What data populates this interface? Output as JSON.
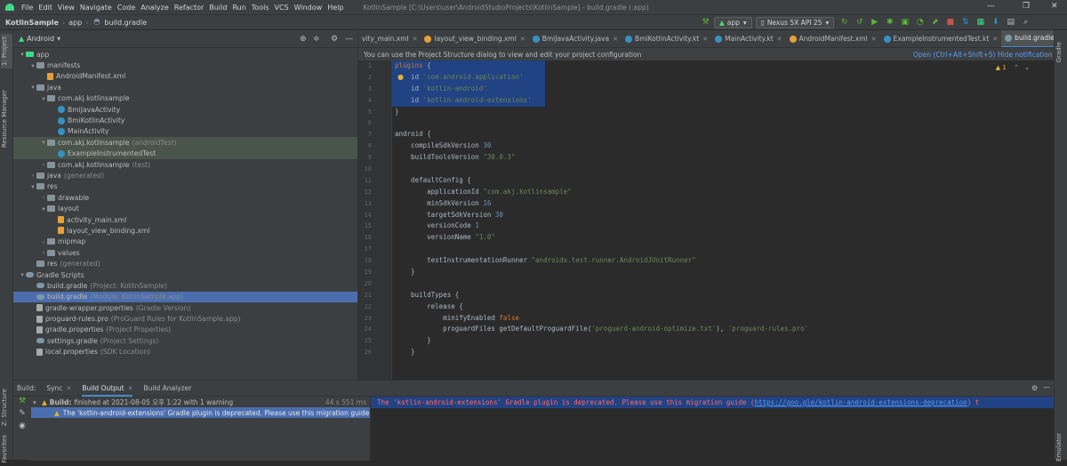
{
  "menubar": {
    "items": [
      "File",
      "Edit",
      "View",
      "Navigate",
      "Code",
      "Analyze",
      "Refactor",
      "Build",
      "Run",
      "Tools",
      "VCS",
      "Window",
      "Help"
    ],
    "title": "KotlinSample [C:\\Users\\user\\AndroidStudioProjects\\KotlinSample] - build.gradle (:app)",
    "minimize": "—",
    "restore": "❐",
    "close": "✕"
  },
  "navbar": {
    "crumbs": [
      "KotlinSample",
      "app",
      "build.gradle"
    ],
    "run_config": "app",
    "device": "Nexus 5X API 25"
  },
  "left_tools": {
    "project": "1: Project",
    "resource": "Resource Manager",
    "structure": "Z: Structure",
    "favorites": "Favorites"
  },
  "right_tools": {
    "gradle": "Gradle",
    "emulator": "Emulator"
  },
  "project": {
    "view": "Android",
    "tree": [
      {
        "label": "app",
        "depth": 0,
        "arrow": "▾",
        "icon": "app"
      },
      {
        "label": "manifests",
        "depth": 1,
        "arrow": "▾",
        "icon": "folder"
      },
      {
        "label": "AndroidManifest.xml",
        "depth": 2,
        "arrow": "",
        "icon": "xml"
      },
      {
        "label": "java",
        "depth": 1,
        "arrow": "▾",
        "icon": "folder"
      },
      {
        "label": "com.akj.kotlinsample",
        "depth": 2,
        "arrow": "▾",
        "icon": "pkg"
      },
      {
        "label": "BmiJavaActivity",
        "depth": 3,
        "arrow": "",
        "icon": "class"
      },
      {
        "label": "BmiKotlinActivity",
        "depth": 3,
        "arrow": "",
        "icon": "class"
      },
      {
        "label": "MainActivity",
        "depth": 3,
        "arrow": "",
        "icon": "class"
      },
      {
        "label": "com.akj.kotlinsample",
        "hint": "(androidTest)",
        "depth": 2,
        "arrow": "▾",
        "icon": "pkg",
        "test": true
      },
      {
        "label": "ExampleInstrumentedTest",
        "depth": 3,
        "arrow": "",
        "icon": "class",
        "test": true
      },
      {
        "label": "com.akj.kotlinsample",
        "hint": "(test)",
        "depth": 2,
        "arrow": "›",
        "icon": "pkg"
      },
      {
        "label": "java",
        "hint": "(generated)",
        "depth": 1,
        "arrow": "›",
        "icon": "folder"
      },
      {
        "label": "res",
        "depth": 1,
        "arrow": "▾",
        "icon": "folder"
      },
      {
        "label": "drawable",
        "depth": 2,
        "arrow": "›",
        "icon": "folder"
      },
      {
        "label": "layout",
        "depth": 2,
        "arrow": "▾",
        "icon": "folder"
      },
      {
        "label": "activity_main.xml",
        "depth": 3,
        "arrow": "",
        "icon": "xml"
      },
      {
        "label": "layout_view_binding.xml",
        "depth": 3,
        "arrow": "",
        "icon": "xml"
      },
      {
        "label": "mipmap",
        "depth": 2,
        "arrow": "›",
        "icon": "folder"
      },
      {
        "label": "values",
        "depth": 2,
        "arrow": "›",
        "icon": "folder"
      },
      {
        "label": "res",
        "hint": "(generated)",
        "depth": 1,
        "arrow": "",
        "icon": "folder"
      },
      {
        "label": "Gradle Scripts",
        "depth": 0,
        "arrow": "▾",
        "icon": "gradle"
      },
      {
        "label": "build.gradle",
        "hint": "(Project: KotlinSample)",
        "depth": 1,
        "arrow": "",
        "icon": "gradle"
      },
      {
        "label": "build.gradle",
        "hint": "(Module: KotlinSample.app)",
        "depth": 1,
        "arrow": "",
        "icon": "gradle",
        "selected": true
      },
      {
        "label": "gradle-wrapper.properties",
        "hint": "(Gradle Version)",
        "depth": 1,
        "arrow": "",
        "icon": "props"
      },
      {
        "label": "proguard-rules.pro",
        "hint": "(ProGuard Rules for KotlinSample.app)",
        "depth": 1,
        "arrow": "",
        "icon": "props"
      },
      {
        "label": "gradle.properties",
        "hint": "(Project Properties)",
        "depth": 1,
        "arrow": "",
        "icon": "props"
      },
      {
        "label": "settings.gradle",
        "hint": "(Project Settings)",
        "depth": 1,
        "arrow": "",
        "icon": "gradle"
      },
      {
        "label": "local.properties",
        "hint": "(SDK Location)",
        "depth": 1,
        "arrow": "",
        "icon": "props"
      }
    ]
  },
  "editor": {
    "tabs": [
      {
        "label": "vity_main.xml",
        "icon": "xml"
      },
      {
        "label": "layout_view_binding.xml",
        "icon": "xml"
      },
      {
        "label": "BmiJavaActivity.java",
        "icon": "class"
      },
      {
        "label": "BmiKotlinActivity.kt",
        "icon": "class"
      },
      {
        "label": "MainActivity.kt",
        "icon": "class"
      },
      {
        "label": "AndroidManifest.xml",
        "icon": "xml"
      },
      {
        "label": "ExampleInstrumentedTest.kt",
        "icon": "class"
      },
      {
        "label": "build.gradle (:app)",
        "icon": "gradle",
        "active": true
      }
    ],
    "info_message": "You can use the Project Structure dialog to view and edit your project configuration",
    "info_open": "Open (Ctrl+Alt+Shift+S)",
    "info_hide": "Hide notification",
    "warning_count": "1",
    "lines": [
      {
        "n": "1",
        "hl": true,
        "parts": [
          [
            "kw",
            "plugins "
          ],
          [
            "",
            "{"
          ]
        ]
      },
      {
        "n": "2",
        "hl": true,
        "parts": [
          [
            "",
            "    id "
          ],
          [
            "str",
            "'com.android.application'"
          ]
        ]
      },
      {
        "n": "3",
        "hl": true,
        "parts": [
          [
            "",
            "    id "
          ],
          [
            "str",
            "'kotlin-android'"
          ]
        ]
      },
      {
        "n": "4",
        "hl": true,
        "parts": [
          [
            "",
            "    id "
          ],
          [
            "str",
            "'kotlin-android-extensions'"
          ]
        ]
      },
      {
        "n": "5",
        "parts": [
          [
            "",
            "}"
          ]
        ]
      },
      {
        "n": "6",
        "parts": [
          [
            "",
            ""
          ]
        ]
      },
      {
        "n": "7",
        "parts": [
          [
            "",
            "android {"
          ]
        ]
      },
      {
        "n": "8",
        "parts": [
          [
            "",
            "    compileSdkVersion "
          ],
          [
            "num",
            "30"
          ]
        ]
      },
      {
        "n": "9",
        "parts": [
          [
            "",
            "    buildToolsVersion "
          ],
          [
            "str",
            "\"30.0.3\""
          ]
        ]
      },
      {
        "n": "10",
        "parts": [
          [
            "",
            ""
          ]
        ]
      },
      {
        "n": "11",
        "parts": [
          [
            "",
            "    defaultConfig {"
          ]
        ]
      },
      {
        "n": "12",
        "parts": [
          [
            "",
            "        applicationId "
          ],
          [
            "str",
            "\"com.akj.kotlinsample\""
          ]
        ]
      },
      {
        "n": "13",
        "parts": [
          [
            "",
            "        minSdkVersion "
          ],
          [
            "num",
            "16"
          ]
        ]
      },
      {
        "n": "14",
        "parts": [
          [
            "",
            "        targetSdkVersion "
          ],
          [
            "num",
            "30"
          ]
        ]
      },
      {
        "n": "15",
        "parts": [
          [
            "",
            "        versionCode "
          ],
          [
            "num",
            "1"
          ]
        ]
      },
      {
        "n": "16",
        "parts": [
          [
            "",
            "        versionName "
          ],
          [
            "str",
            "\"1.0\""
          ]
        ]
      },
      {
        "n": "17",
        "parts": [
          [
            "",
            ""
          ]
        ]
      },
      {
        "n": "18",
        "parts": [
          [
            "",
            "        testInstrumentationRunner "
          ],
          [
            "str",
            "\"androidx.test.runner.AndroidJUnitRunner\""
          ]
        ]
      },
      {
        "n": "19",
        "parts": [
          [
            "",
            "    }"
          ]
        ]
      },
      {
        "n": "20",
        "parts": [
          [
            "",
            ""
          ]
        ]
      },
      {
        "n": "21",
        "parts": [
          [
            "",
            "    buildTypes {"
          ]
        ]
      },
      {
        "n": "22",
        "parts": [
          [
            "",
            "        release {"
          ]
        ]
      },
      {
        "n": "23",
        "parts": [
          [
            "",
            "            minifyEnabled "
          ],
          [
            "kw",
            "false"
          ]
        ]
      },
      {
        "n": "24",
        "parts": [
          [
            "",
            "            proguardFiles getDefaultProguardFile("
          ],
          [
            "str",
            "'proguard-android-optimize.txt'"
          ],
          [
            "",
            "), "
          ],
          [
            "str",
            "'proguard-rules.pro'"
          ]
        ]
      },
      {
        "n": "25",
        "parts": [
          [
            "",
            "        }"
          ]
        ]
      },
      {
        "n": "26",
        "parts": [
          [
            "",
            "    }"
          ]
        ]
      }
    ]
  },
  "build": {
    "tabs": [
      {
        "label": "Build:"
      },
      {
        "label": "Sync",
        "closable": true
      },
      {
        "label": "Build Output",
        "closable": true,
        "active": true
      },
      {
        "label": "Build Analyzer"
      }
    ],
    "status_label": "Build:",
    "status_text": "finished at 2021-08-05 오후 1:22 with 1 warning",
    "elapsed": "44 s 551 ms",
    "warning_text": "The 'kotlin-android-extensions' Gradle plugin is deprecated. Please use this migration guide (https://go",
    "console_text": "The 'kotlin-android-extensions' Gradle plugin is deprecated. Please use this migration guide (",
    "console_link": "https://goo.gle/kotlin-android-extensions-deprecation",
    "console_tail": ") t"
  },
  "colors": {
    "accent": "#4a88c7",
    "selection": "#4b6eaf",
    "highlight": "#214283",
    "warning": "#e2b13c",
    "error_text": "#ff6b68"
  }
}
